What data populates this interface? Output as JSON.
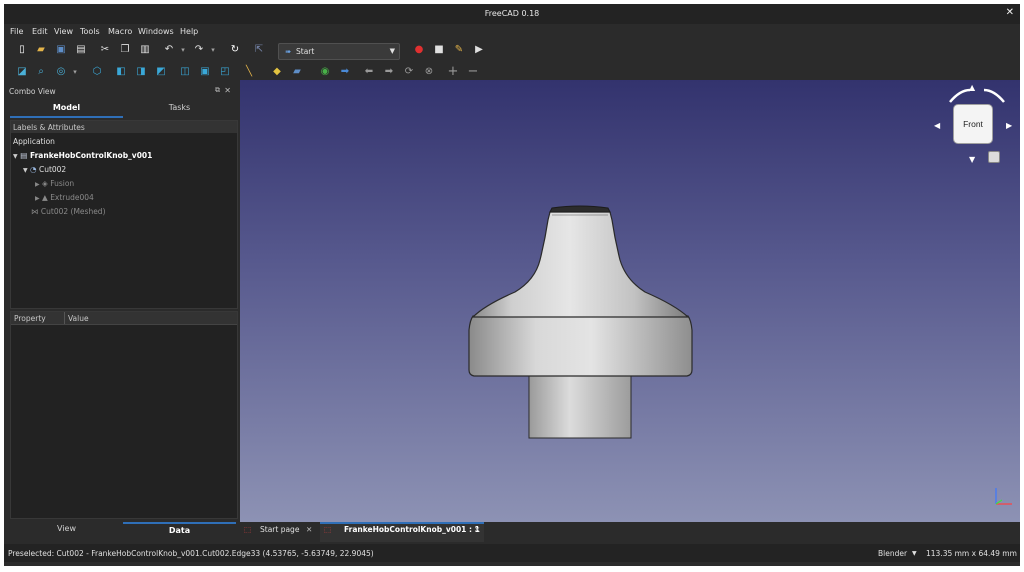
{
  "app": {
    "title": "FreeCAD 0.18"
  },
  "menu": [
    "File",
    "Edit",
    "View",
    "Tools",
    "Macro",
    "Windows",
    "Help"
  ],
  "toolbar": {
    "workbench": "Start"
  },
  "combo_view": {
    "title": "Combo View",
    "tabs": [
      "Model",
      "Tasks"
    ],
    "active_tab": "Model",
    "section_header": "Labels & Attributes",
    "tree": {
      "root_label": "Application",
      "items": [
        {
          "label": "FrankeHobControlKnob_v001",
          "icon": "document-icon"
        },
        {
          "label": "Cut002",
          "icon": "cut-icon"
        },
        {
          "label": "Fusion",
          "icon": "fusion-icon"
        },
        {
          "label": "Extrude004",
          "icon": "extrude-icon"
        },
        {
          "label": "Cut002 (Meshed)",
          "icon": "mesh-icon"
        }
      ]
    },
    "property_headers": [
      "Property",
      "Value"
    ],
    "bottom_tabs": [
      "View",
      "Data"
    ],
    "active_bottom_tab": "Data"
  },
  "navcube": {
    "face": "Front"
  },
  "doc_tabs": [
    "Start page",
    "FrankeHobControlKnob_v001 : 1"
  ],
  "status": {
    "preselected": "Preselected: Cut002 - FrankeHobControlKnob_v001.Cut002.Edge33 (4.53765, -5.63749, 22.9045)",
    "nav_style": "Blender",
    "dimensions": "113.35 mm x 64.49 mm"
  },
  "colors": {
    "accent": "#2f6fb8",
    "viewport_top": "#33336e",
    "viewport_bottom": "#8d92b4"
  }
}
